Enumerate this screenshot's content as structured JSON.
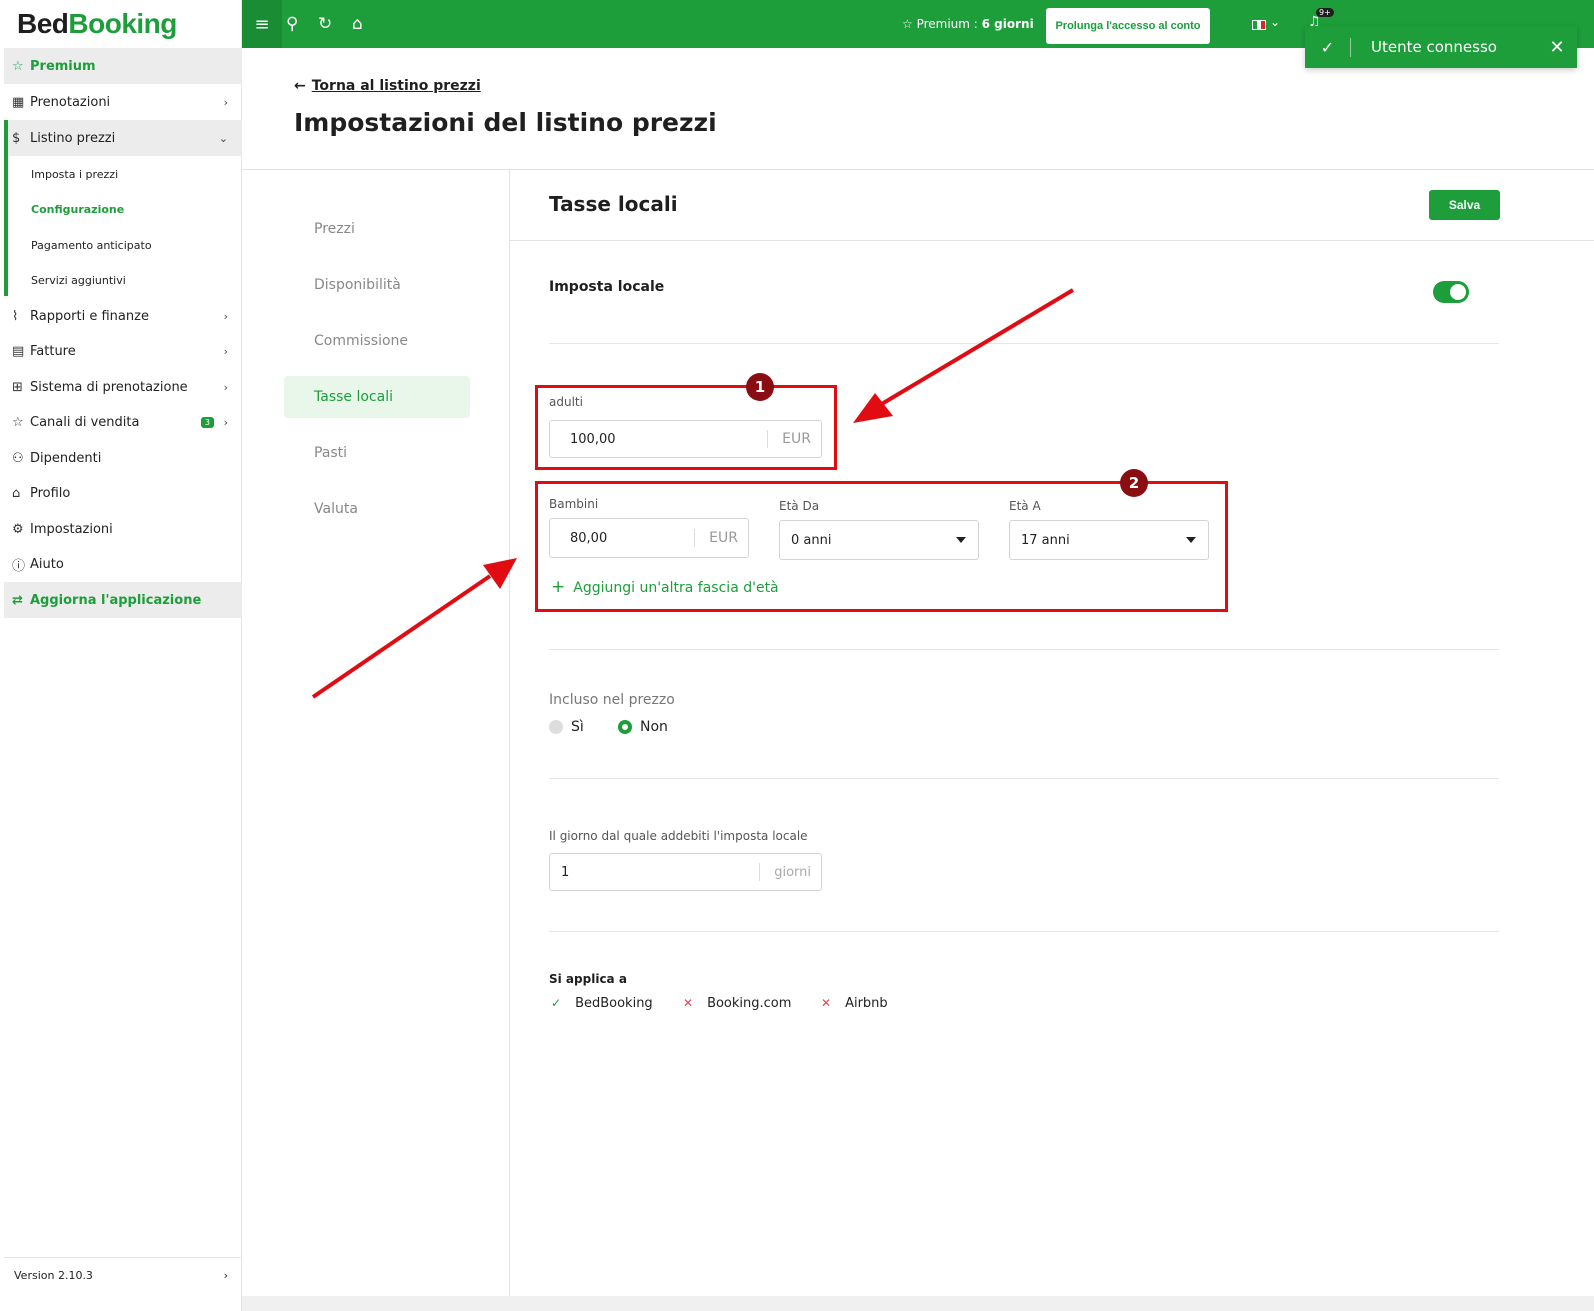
{
  "app": {
    "logo_part1": "Bed",
    "logo_part2": "Booking"
  },
  "sidebar": {
    "premium": "Premium",
    "items": [
      {
        "label": "Prenotazioni",
        "icon": "calendar-icon"
      },
      {
        "label": "Listino prezzi",
        "icon": "dollar-icon"
      },
      {
        "label": "Rapporti e finanze",
        "icon": "chart-icon"
      },
      {
        "label": "Fatture",
        "icon": "invoice-icon"
      },
      {
        "label": "Sistema di prenotazione",
        "icon": "grid-icon"
      },
      {
        "label": "Canali di vendita",
        "icon": "star-icon",
        "badge": "3"
      },
      {
        "label": "Dipendenti",
        "icon": "user-add-icon"
      },
      {
        "label": "Profilo",
        "icon": "building-icon"
      },
      {
        "label": "Impostazioni",
        "icon": "gear-icon"
      },
      {
        "label": "Aiuto",
        "icon": "info-icon"
      }
    ],
    "subitems": [
      "Imposta i prezzi",
      "Configurazione",
      "Pagamento anticipato",
      "Servizi aggiuntivi"
    ],
    "update": "Aggiorna l'applicazione",
    "version": "Version 2.10.3"
  },
  "topbar": {
    "premium_prefix": "Premium : ",
    "premium_days": "6 giorni",
    "extend": "Prolunga l'accesso al conto",
    "notif_count": "9+"
  },
  "toast": {
    "message": "Utente connesso"
  },
  "header": {
    "back": "Torna al listino prezzi",
    "title": "Impostazioni del listino prezzi"
  },
  "tabs": [
    "Prezzi",
    "Disponibilità",
    "Commissione",
    "Tasse locali",
    "Pasti",
    "Valuta"
  ],
  "section": {
    "title": "Tasse locali",
    "save": "Salva",
    "tax_label": "Imposta locale",
    "adults_label": "adulti",
    "adults_value": "100,00",
    "currency": "EUR",
    "children_label": "Bambini",
    "children_value": "80,00",
    "age_from_label": "Età Da",
    "age_from_value": "0 anni",
    "age_to_label": "Età A",
    "age_to_value": "17 anni",
    "add_age": "Aggiungi un'altra fascia d'età",
    "included_label": "Incluso nel prezzo",
    "yes": "Sì",
    "no": "Non",
    "day_label": "Il giorno dal quale addebiti l'imposta locale",
    "day_value": "1",
    "day_unit": "giorni",
    "applies_label": "Si applica a",
    "channels": [
      {
        "name": "BedBooking",
        "mark": "✓"
      },
      {
        "name": "Booking.com",
        "mark": "✕"
      },
      {
        "name": "Airbnb",
        "mark": "✕"
      }
    ]
  },
  "annotations": {
    "n1": "1",
    "n2": "2"
  },
  "colors": {
    "brand": "#1d9e3b",
    "annotation": "#e10b12"
  }
}
